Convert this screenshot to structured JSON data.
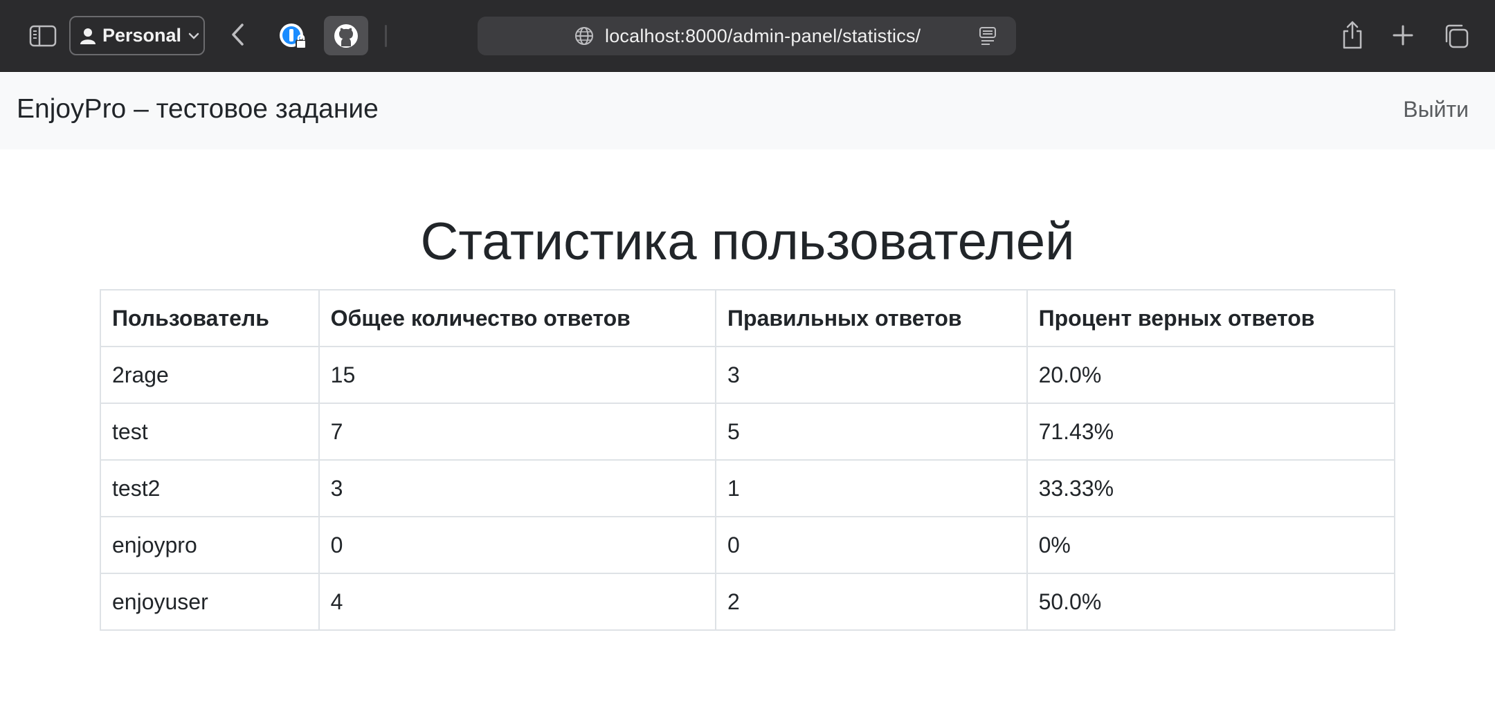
{
  "browser": {
    "profile_label": "Personal",
    "url": "localhost:8000/admin-panel/statistics/",
    "icons": {
      "sidebar": "sidebar-icon",
      "profile": "person-icon",
      "back": "chevron-left-icon",
      "password_manager": "1password-icon",
      "github": "github-icon",
      "site": "globe-icon",
      "reader": "reader-mode-icon",
      "share": "share-icon",
      "new_tab": "plus-icon",
      "tabs": "tab-overview-icon"
    }
  },
  "navbar": {
    "brand": "EnjoyPro – тестовое задание",
    "logout_label": "Выйти"
  },
  "main": {
    "title": "Статистика пользователей",
    "table": {
      "headers": [
        "Пользователь",
        "Общее количество ответов",
        "Правильных ответов",
        "Процент верных ответов"
      ],
      "rows": [
        [
          "2rage",
          "15",
          "3",
          "20.0%"
        ],
        [
          "test",
          "7",
          "5",
          "71.43%"
        ],
        [
          "test2",
          "3",
          "1",
          "33.33%"
        ],
        [
          "enjoypro",
          "0",
          "0",
          "0%"
        ],
        [
          "enjoyuser",
          "4",
          "2",
          "50.0%"
        ]
      ]
    }
  },
  "colors": {
    "chrome_bg": "#2b2b2d",
    "navbar_bg": "#f8f9fa",
    "text": "#212529",
    "border": "#dee2e6"
  }
}
